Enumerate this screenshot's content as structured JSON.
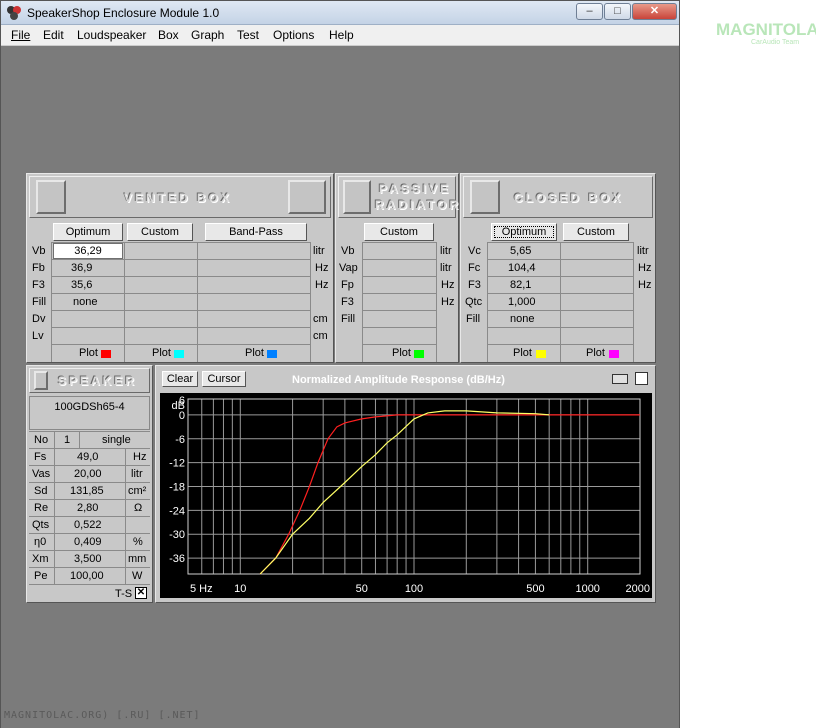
{
  "window": {
    "title": "SpeakerShop Enclosure Module 1.0"
  },
  "menu": [
    "File",
    "Edit",
    "Loudspeaker",
    "Box",
    "Graph",
    "Test",
    "Options",
    "Help"
  ],
  "logo": {
    "text": "MAGNITOLA",
    "sub": "CarAudio Team"
  },
  "vented": {
    "title": "VENTED BOX",
    "buttons": [
      "Optimum",
      "Custom",
      "Band-Pass"
    ],
    "rows": [
      {
        "label": "Vb",
        "value": "36,29",
        "unit": "litr"
      },
      {
        "label": "Fb",
        "value": "36,9",
        "unit": "Hz"
      },
      {
        "label": "F3",
        "value": "35,6",
        "unit": "Hz"
      },
      {
        "label": "Fill",
        "value": "none",
        "unit": ""
      },
      {
        "label": "Dv",
        "value": "",
        "unit": "cm"
      },
      {
        "label": "Lv",
        "value": "",
        "unit": "cm"
      }
    ],
    "plot_label": "Plot",
    "plot_colors": [
      "#ff0000",
      "#00ffff",
      "#0080ff"
    ]
  },
  "passive": {
    "title_line1": "PASSIVE",
    "title_line2": "RADIATOR",
    "button": "Custom",
    "rows": [
      {
        "label": "Vb",
        "unit": "litr"
      },
      {
        "label": "Vap",
        "unit": "litr"
      },
      {
        "label": "Fp",
        "unit": "Hz"
      },
      {
        "label": "F3",
        "unit": "Hz"
      },
      {
        "label": "Fill",
        "unit": ""
      }
    ],
    "plot_label": "Plot",
    "plot_color": "#00ff00"
  },
  "closed": {
    "title": "CLOSED BOX",
    "buttons": [
      "Optimum",
      "Custom"
    ],
    "rows": [
      {
        "label": "Vc",
        "value": "5,65",
        "unit": "litr"
      },
      {
        "label": "Fc",
        "value": "104,4",
        "unit": "Hz"
      },
      {
        "label": "F3",
        "value": "82,1",
        "unit": "Hz"
      },
      {
        "label": "Qtc",
        "value": "1,000",
        "unit": ""
      },
      {
        "label": "Fill",
        "value": "none",
        "unit": ""
      }
    ],
    "plot_label": "Plot",
    "plot_colors": [
      "#ffff00",
      "#ff00ff"
    ]
  },
  "speaker": {
    "title": "SPEAKER",
    "model": "100GDSh65-4",
    "no_label": "No",
    "no_value": "1",
    "mode": "single",
    "params": [
      {
        "label": "Fs",
        "value": "49,0",
        "unit": "Hz"
      },
      {
        "label": "Vas",
        "value": "20,00",
        "unit": "litr"
      },
      {
        "label": "Sd",
        "value": "131,85",
        "unit": "cm²"
      },
      {
        "label": "Re",
        "value": "2,80",
        "unit": "Ω"
      },
      {
        "label": "Qts",
        "value": "0,522",
        "unit": ""
      },
      {
        "label": "η0",
        "value": "0,409",
        "unit": "%"
      },
      {
        "label": "Xm",
        "value": "3,500",
        "unit": "mm"
      },
      {
        "label": "Pe",
        "value": "100,00",
        "unit": "W"
      }
    ],
    "ts_label": "T-S"
  },
  "graph": {
    "clear_label": "Clear",
    "cursor_label": "Cursor"
  },
  "chart_data": {
    "type": "line",
    "title": "Normalized Amplitude Response (dB/Hz)",
    "ylabel": "dB",
    "x_scale": "log",
    "xlim": [
      5,
      2000
    ],
    "ylim": [
      -40,
      4
    ],
    "yticks": [
      "dB",
      "6",
      "0",
      "-6",
      "-12",
      "-18",
      "-24",
      "-30",
      "-36"
    ],
    "xticks": [
      "5 Hz",
      "10",
      "50",
      "100",
      "500",
      "1000",
      "2000"
    ],
    "grid": true,
    "series": [
      {
        "color": "#ff2020",
        "x": [
          13,
          16,
          19,
          22,
          25,
          28,
          32,
          36,
          40,
          50,
          60,
          80,
          100,
          150,
          200,
          500,
          2000
        ],
        "y": [
          -40,
          -36,
          -30,
          -24,
          -18,
          -12,
          -6,
          -3,
          -2,
          -1,
          -0.5,
          0,
          0,
          0,
          0,
          0,
          0
        ]
      },
      {
        "color": "#ffff66",
        "x": [
          13,
          16,
          20,
          25,
          30,
          40,
          50,
          60,
          70,
          80,
          100,
          120,
          150,
          200,
          300,
          500,
          600
        ],
        "y": [
          -40,
          -36,
          -30,
          -26,
          -22,
          -17,
          -13,
          -10,
          -7,
          -5,
          -1,
          0.5,
          1,
          1,
          0.5,
          0.3,
          0
        ]
      }
    ]
  },
  "footer": "MAGNITOLAC.ORG) [.RU] [.NET]"
}
